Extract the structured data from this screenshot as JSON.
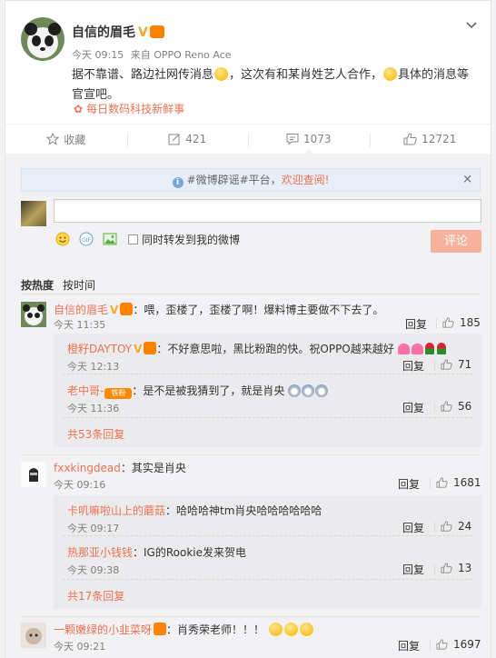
{
  "post": {
    "author": "自信的眉毛",
    "verified_mark": "V",
    "time": "今天 09:15",
    "source": "来自 OPPO Reno Ace",
    "text_1": "据不靠谱、路边社网传消息",
    "text_2": "，这次有和某肖姓艺人合作，",
    "text_3": "具体的消息等官宣吧。",
    "from_label": "每日数码科技新鲜事"
  },
  "actions": {
    "favorite": "收藏",
    "repost": "421",
    "comment": "1073",
    "like": "12721"
  },
  "notice": {
    "prefix": "#微博辟谣#平台，",
    "link": "欢迎查阅!",
    "close": "×"
  },
  "composer": {
    "placeholder": "",
    "repost_label": "同时转发到我的微博",
    "submit_label": "评论"
  },
  "sort": {
    "hot": "按热度",
    "time": "按时间"
  },
  "comments": [
    {
      "name": "自信的眉毛",
      "text": "：喂，歪楼了，歪楼了啊！爆料博主要做不下去了。",
      "time": "今天 11:35",
      "reply": "回复",
      "likes": "185",
      "replies": [
        {
          "name": "橙籽DAYTOY",
          "text": "：不好意思啦，黑比粉跑的快。祝OPPO越来越好",
          "time": "今天 12:13",
          "reply": "回复",
          "likes": "71"
        },
        {
          "name": "老中哥-",
          "fan_badge": "铁粉",
          "text": "：是不是被我猜到了，就是肖央",
          "time": "今天 11:36",
          "reply": "回复",
          "likes": "56"
        }
      ],
      "more": "共53条回复"
    },
    {
      "name": "fxxkingdead",
      "text": "：其实是肖央",
      "time": "今天 09:16",
      "reply": "回复",
      "likes": "1681",
      "replies": [
        {
          "name": "卡叽嘛啦山上的蘑菇",
          "text": "：哈哈哈神tm肖央哈哈哈哈哈哈",
          "time": "今天 09:17",
          "reply": "回复",
          "likes": "24"
        },
        {
          "name": "热那亚小钱钱",
          "text": "：IG的Rookie发来贺电",
          "time": "今天 09:38",
          "reply": "回复",
          "likes": "13"
        }
      ],
      "more": "共17条回复"
    },
    {
      "name": "一颗嫩绿的小韭菜呀",
      "text": "：肖秀荣老师！！！",
      "time": "今天 09:21",
      "reply": "回复",
      "likes": "1697"
    }
  ],
  "colors": {
    "accent": "#eb7350",
    "verified": "#f7a82b",
    "badge": "#ff8200"
  }
}
